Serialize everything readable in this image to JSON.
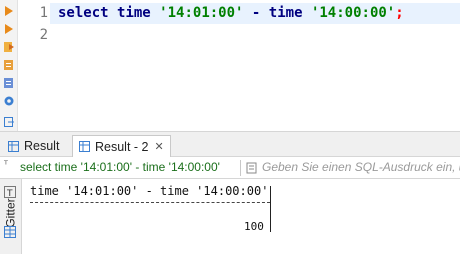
{
  "editor": {
    "line_numbers": [
      "1",
      "2"
    ],
    "code": {
      "kw1": "select",
      "id1": "time",
      "str1": "'14:01:00'",
      "op": "-",
      "id2": "time",
      "str2": "'14:00:00'",
      "semi": ";"
    }
  },
  "result_tabs": [
    {
      "label": "Result"
    },
    {
      "label": "Result - 2",
      "close": "✕"
    }
  ],
  "filter": {
    "query_text": "select time '14:01:00' - time '14:00:00'",
    "placeholder": "Geben Sie einen SQL-Ausdruck ein, um die Ergebnisse zu filtern"
  },
  "side_panel": {
    "gitter_label": "Gitter"
  },
  "result": {
    "header": "time '14:01:00' - time '14:00:00'",
    "value": "100"
  },
  "colors": {
    "keyword": "#000080",
    "string": "#008000",
    "semicolon": "#ff0000",
    "line_highlight": "#e8f2fe"
  }
}
